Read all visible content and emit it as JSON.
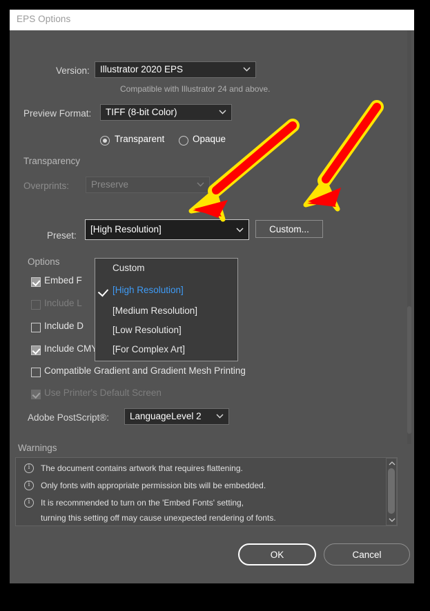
{
  "window": {
    "title": "EPS Options"
  },
  "version_row": {
    "label": "Version:",
    "value": "Illustrator 2020 EPS",
    "hint": "Compatible with Illustrator 24 and above."
  },
  "preview_row": {
    "label": "Preview Format:",
    "value": "TIFF (8-bit Color)",
    "radio_transparent": "Transparent",
    "radio_opaque": "Opaque",
    "selected_radio": "Transparent"
  },
  "transparency": {
    "title": "Transparency",
    "overprints_label": "Overprints:",
    "overprints_value": "Preserve",
    "preset_label": "Preset:",
    "preset_value": "[High Resolution]",
    "custom_button": "Custom..."
  },
  "preset_dropdown": {
    "open": true,
    "selected": "[High Resolution]",
    "options": [
      {
        "label": "Custom",
        "checked": false
      },
      {
        "label": "[High Resolution]",
        "checked": true
      },
      {
        "label": "[Medium Resolution]",
        "checked": false
      },
      {
        "label": "[Low Resolution]",
        "checked": false
      },
      {
        "label": "[For Complex Art]",
        "checked": false
      }
    ]
  },
  "options": {
    "title": "Options",
    "items": [
      {
        "label": "Embed Fonts (for other applications)",
        "short": "Embed F",
        "checked": true,
        "enabled": true
      },
      {
        "label": "Include Linked Files",
        "short": "Include L",
        "checked": false,
        "enabled": false
      },
      {
        "label": "Include Document Thumbnails",
        "short": "Include D",
        "checked": false,
        "enabled": true
      },
      {
        "label": "Include CMYK PostScript in RGB Files",
        "short": "Include CMYK PostScript in RGB Files",
        "checked": true,
        "enabled": true
      },
      {
        "label": "Compatible Gradient and Gradient Mesh Printing",
        "short": "Compatible Gradient and Gradient Mesh Printing",
        "checked": false,
        "enabled": true
      },
      {
        "label": "Use Printer's Default Screen",
        "short": "Use Printer's Default Screen",
        "checked": true,
        "enabled": false
      }
    ],
    "postscript_label": "Adobe PostScript®:",
    "postscript_value": "LanguageLevel 2"
  },
  "warnings": {
    "title": "Warnings",
    "items": [
      "The document contains artwork that requires flattening.",
      "Only fonts with appropriate permission bits will be embedded.",
      "It is recommended to turn on the 'Embed Fonts' setting,",
      "turning this setting off may cause unexpected rendering of fonts."
    ]
  },
  "footer": {
    "ok": "OK",
    "cancel": "Cancel"
  },
  "annotations": {
    "arrow_color": "#FF0000",
    "arrow_outline": "#FFE500",
    "arrow_count": 2
  },
  "colors": {
    "dialog_bg": "#535353",
    "titlebar_bg": "#FFFFFF",
    "field_bg": "#2B2B2B",
    "accent_selected": "#3F9BF5"
  }
}
